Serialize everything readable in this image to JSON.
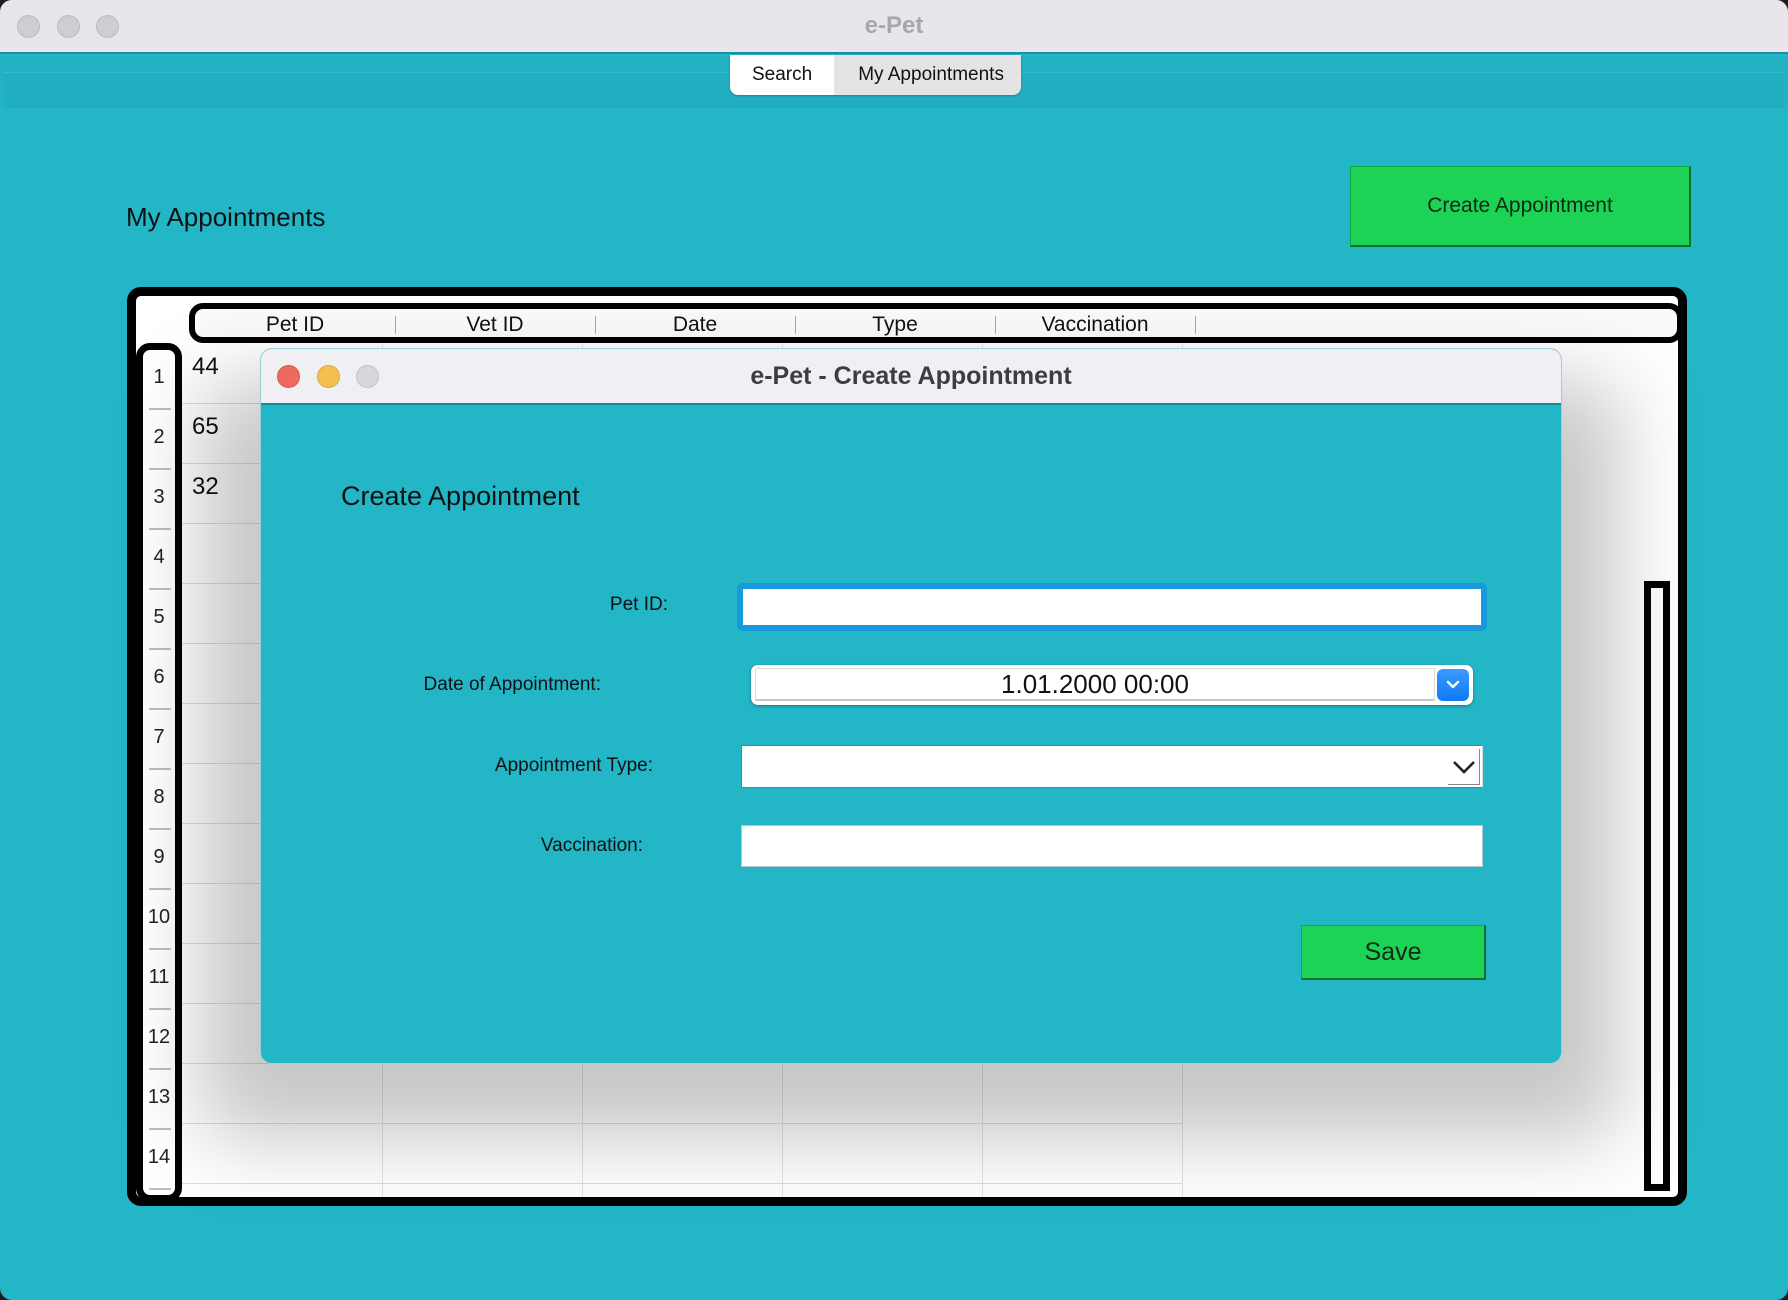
{
  "window": {
    "title": "e-Pet"
  },
  "tabs": [
    {
      "label": "Search",
      "active": true
    },
    {
      "label": "My Appointments",
      "active": false
    }
  ],
  "main": {
    "heading": "My Appointments",
    "create_button_label": "Create Appointment"
  },
  "table": {
    "columns": [
      "Pet ID",
      "Vet ID",
      "Date",
      "Type",
      "Vaccination"
    ],
    "row_numbers": [
      "1",
      "2",
      "3",
      "4",
      "5",
      "6",
      "7",
      "8",
      "9",
      "10",
      "11",
      "12",
      "13",
      "14"
    ],
    "rows": [
      {
        "pet_id": "44"
      },
      {
        "pet_id": "65"
      },
      {
        "pet_id": "32"
      }
    ]
  },
  "dialog": {
    "title": "e-Pet - Create Appointment",
    "heading": "Create Appointment",
    "fields": {
      "pet_id": {
        "label": "Pet ID:",
        "value": ""
      },
      "date": {
        "label": "Date of Appointment:",
        "value": "1.01.2000 00:00"
      },
      "type": {
        "label": "Appointment Type:",
        "value": ""
      },
      "vaccination": {
        "label": "Vaccination:",
        "value": ""
      }
    },
    "save_label": "Save"
  },
  "colors": {
    "background": "#23b6c7",
    "button_green": "#1dd356",
    "focus_blue": "#1899dc",
    "close_red": "#ee6a5f",
    "minimize_yellow": "#f5bf4f"
  }
}
